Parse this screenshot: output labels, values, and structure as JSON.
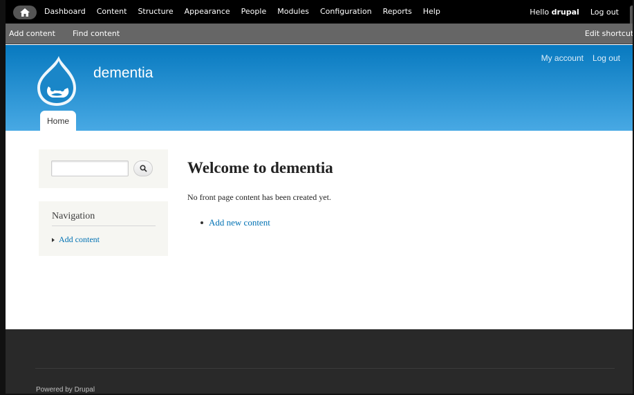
{
  "toolbar": {
    "home_icon": "home-icon",
    "menu": [
      "Dashboard",
      "Content",
      "Structure",
      "Appearance",
      "People",
      "Modules",
      "Configuration",
      "Reports",
      "Help"
    ],
    "hello_prefix": "Hello ",
    "username": "drupal",
    "logout": "Log out"
  },
  "shortcuts": {
    "items": [
      "Add content",
      "Find content"
    ],
    "edit": "Edit shortcuts"
  },
  "header": {
    "site_name": "dementia",
    "logo_icon": "drupal-drop-logo",
    "secondary_menu": [
      "My account",
      "Log out"
    ],
    "tab": "Home"
  },
  "sidebar": {
    "search": {
      "value": "",
      "button_icon": "search-icon"
    },
    "navigation": {
      "title": "Navigation",
      "items": [
        "Add content"
      ]
    }
  },
  "main": {
    "title": "Welcome to dementia",
    "text": "No front page content has been created yet.",
    "links": [
      "Add new content"
    ]
  },
  "footer": {
    "powered_prefix": "Powered by ",
    "powered_link": "Drupal"
  },
  "colors": {
    "header_top": "#0779bf",
    "header_bottom": "#48a9e4",
    "link": "#0071b3",
    "footer_bg": "#292929"
  }
}
